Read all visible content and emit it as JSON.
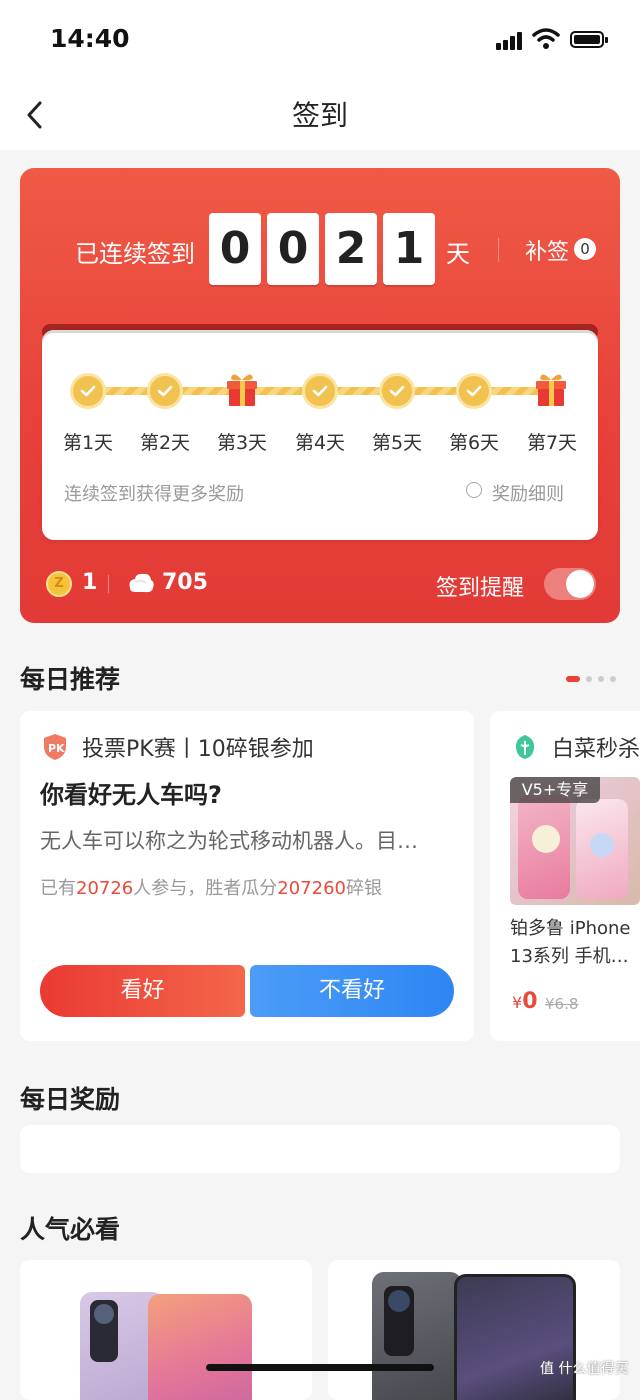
{
  "status_bar": {
    "time": "14:40"
  },
  "nav": {
    "title": "签到"
  },
  "checkin": {
    "streak_label": "已连续签到",
    "digits": [
      "0",
      "0",
      "2",
      "1"
    ],
    "day_suffix": "天",
    "makeup_label": "补签",
    "makeup_count": "0",
    "days": [
      "第1天",
      "第2天",
      "第3天",
      "第4天",
      "第5天",
      "第6天",
      "第7天"
    ],
    "day_icons": [
      "check-icon",
      "check-icon",
      "gift-icon",
      "check-icon",
      "check-icon",
      "check-icon",
      "gift-icon"
    ],
    "hint": "连续签到获得更多奖励",
    "rules_label": "奖励细则",
    "coin_value": "1",
    "coin_glyph": "Z",
    "silver_value": "705",
    "remind_label": "签到提醒",
    "remind_on": true
  },
  "daily_recommend": {
    "title": "每日推荐",
    "pk": {
      "header": "投票PK赛丨10碎银参加",
      "question": "你看好无人车吗?",
      "description": "无人车可以称之为轮式移动机器人。目…",
      "stats_prefix": "已有",
      "participants": "20726",
      "stats_mid": "人参与，胜者瓜分",
      "prize": "207260",
      "stats_suffix": "碎银",
      "yes_label": "看好",
      "no_label": "不看好"
    },
    "deal": {
      "header": "白菜秒杀",
      "badge": "V5+专享",
      "name": "铂多鲁 iPhone 13系列 手机…",
      "currency": "¥",
      "price": "0",
      "original_price": "¥6.8"
    }
  },
  "daily_reward": {
    "title": "每日奖励"
  },
  "popular": {
    "title": "人气必看"
  },
  "watermark": "值 什么值得买",
  "colors": {
    "primary_red": "#e8413a",
    "gold": "#f1c24f",
    "blue": "#2e86f4"
  }
}
